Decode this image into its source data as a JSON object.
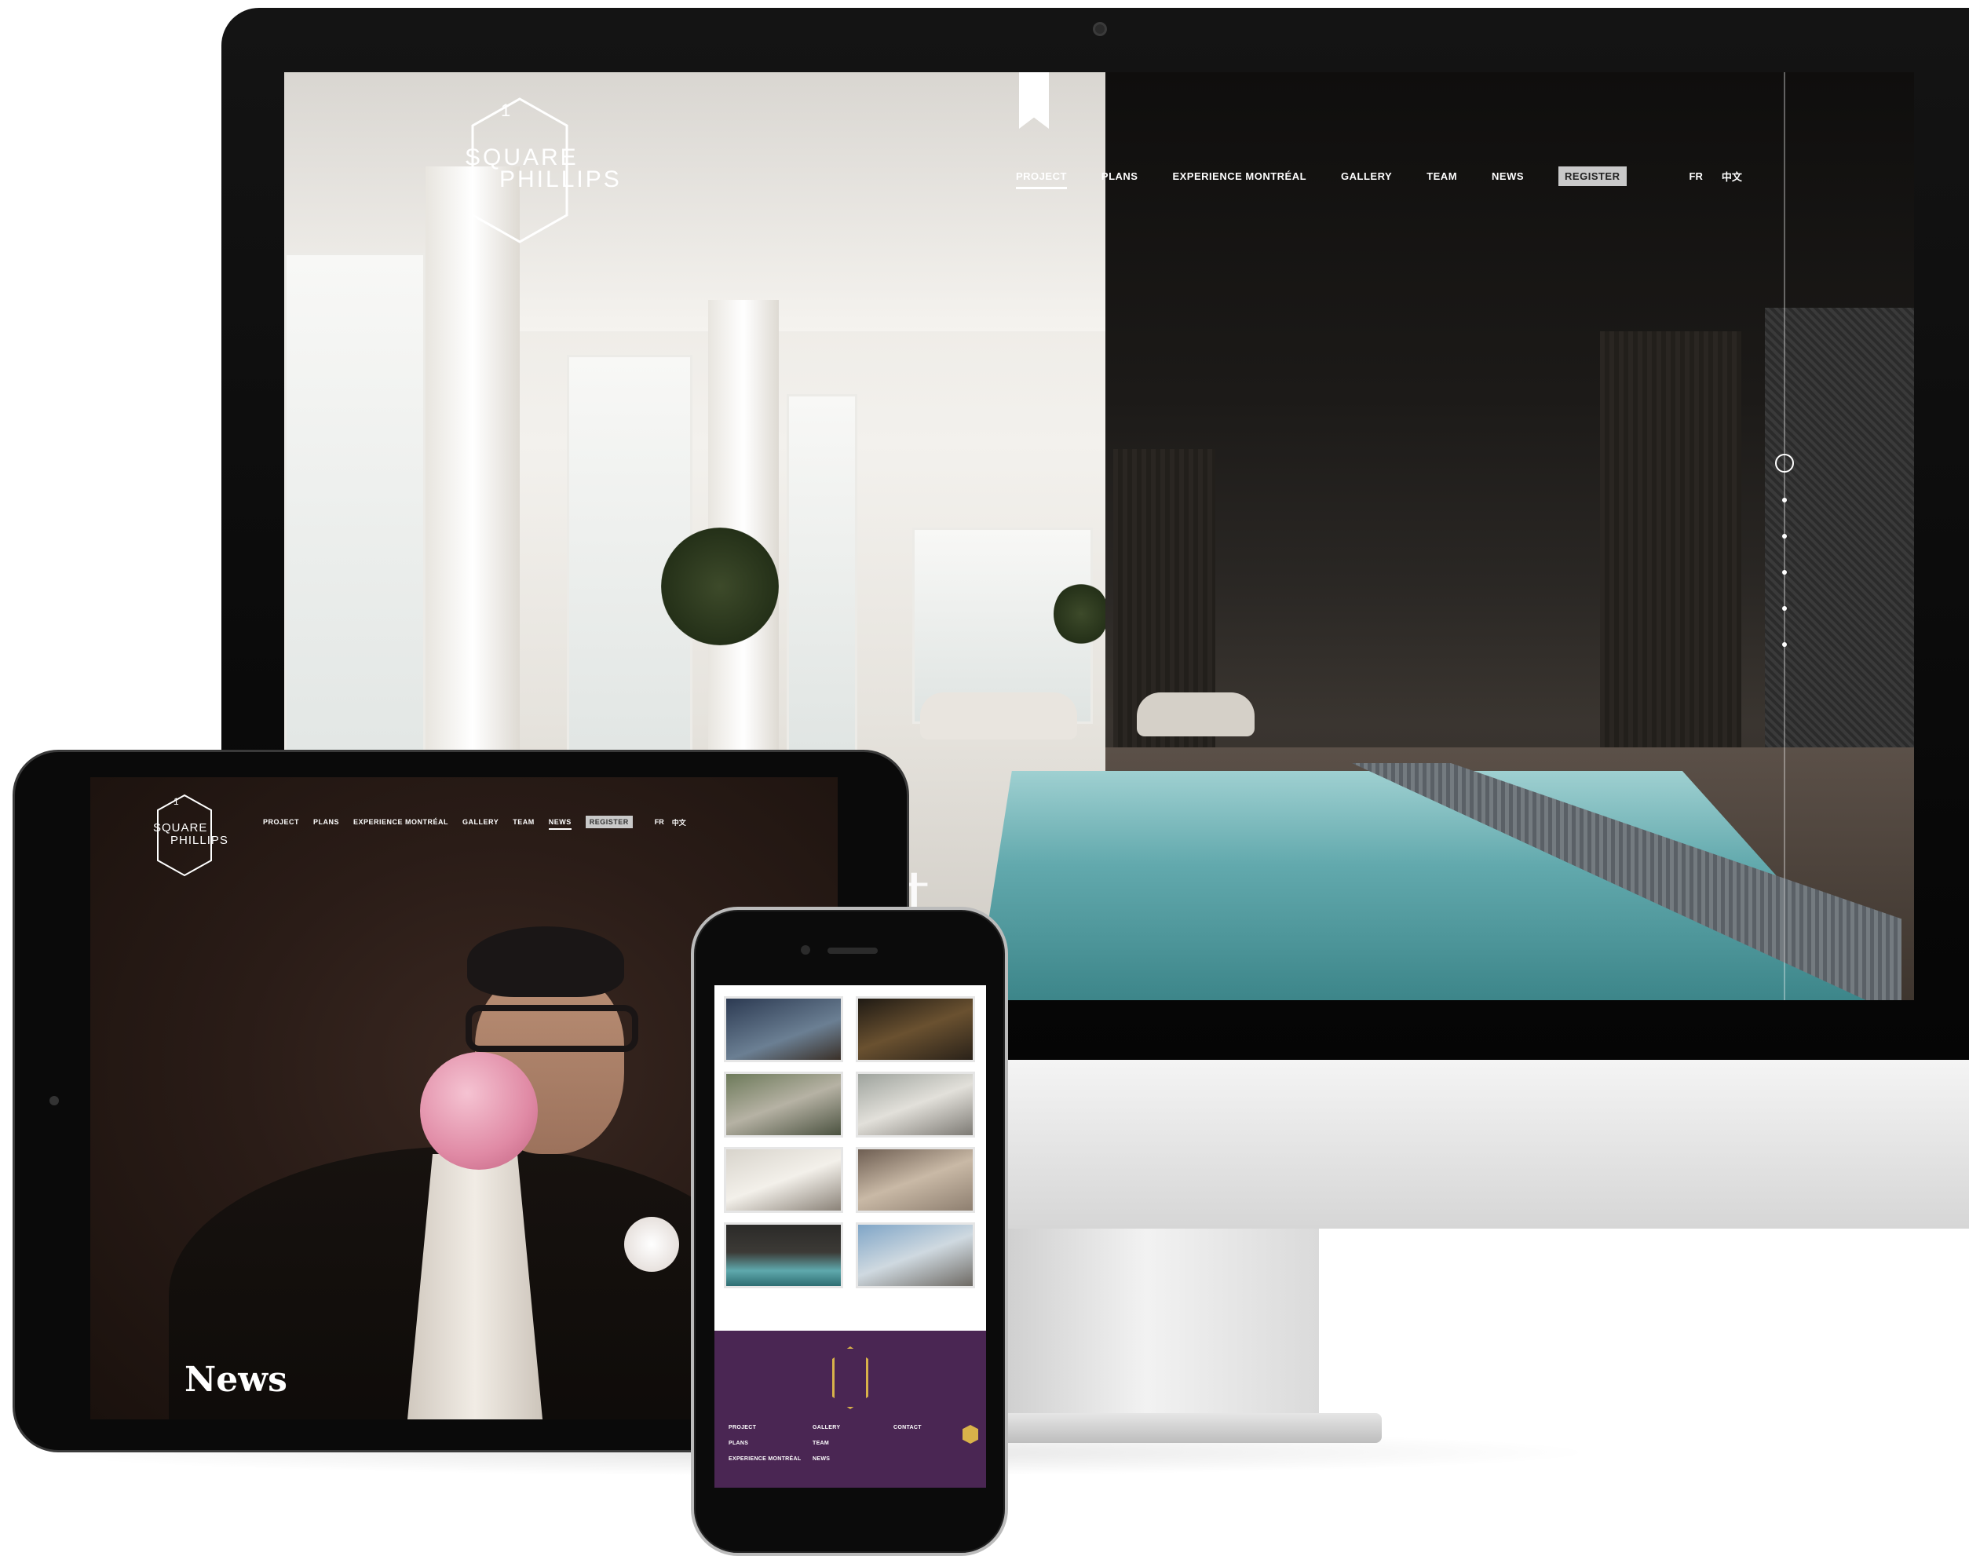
{
  "desktop": {
    "logo": {
      "number": "1",
      "line1": "SQUARE",
      "line2": "PHILLIPS"
    },
    "nav": {
      "project": "PROJECT",
      "plans": "PLANS",
      "experience": "EXPERIENCE MONTRÉAL",
      "gallery": "GALLERY",
      "team": "TEAM",
      "news": "NEWS",
      "register": "REGISTER",
      "lang_fr": "FR",
      "lang_zh": "中文",
      "active": "PROJECT"
    },
    "hero_fragment": "t"
  },
  "tablet": {
    "logo": {
      "number": "1",
      "line1": "SQUARE",
      "line2": "PHILLIPS"
    },
    "nav": {
      "project": "PROJECT",
      "plans": "PLANS",
      "experience": "EXPERIENCE MONTRÉAL",
      "gallery": "GALLERY",
      "team": "TEAM",
      "news": "NEWS",
      "register": "REGISTER",
      "lang_fr": "FR",
      "lang_zh": "中文",
      "active": "NEWS"
    },
    "page_title": "News"
  },
  "phone": {
    "gallery_count": 8,
    "footer": {
      "col1": [
        "PROJECT",
        "PLANS",
        "EXPERIENCE MONTRÉAL"
      ],
      "col2": [
        "GALLERY",
        "TEAM",
        "NEWS"
      ],
      "col3": [
        "CONTACT"
      ]
    }
  },
  "colors": {
    "footer_purple": "#4a2653",
    "logo_gold": "#d8b24a",
    "register_bg": "#c9c9c9",
    "pool_water": "#62a9ad"
  },
  "icons": [
    "bookmark-icon",
    "slide-indicator-ring-icon",
    "slide-dot-icon",
    "logo-hexagon-icon"
  ]
}
